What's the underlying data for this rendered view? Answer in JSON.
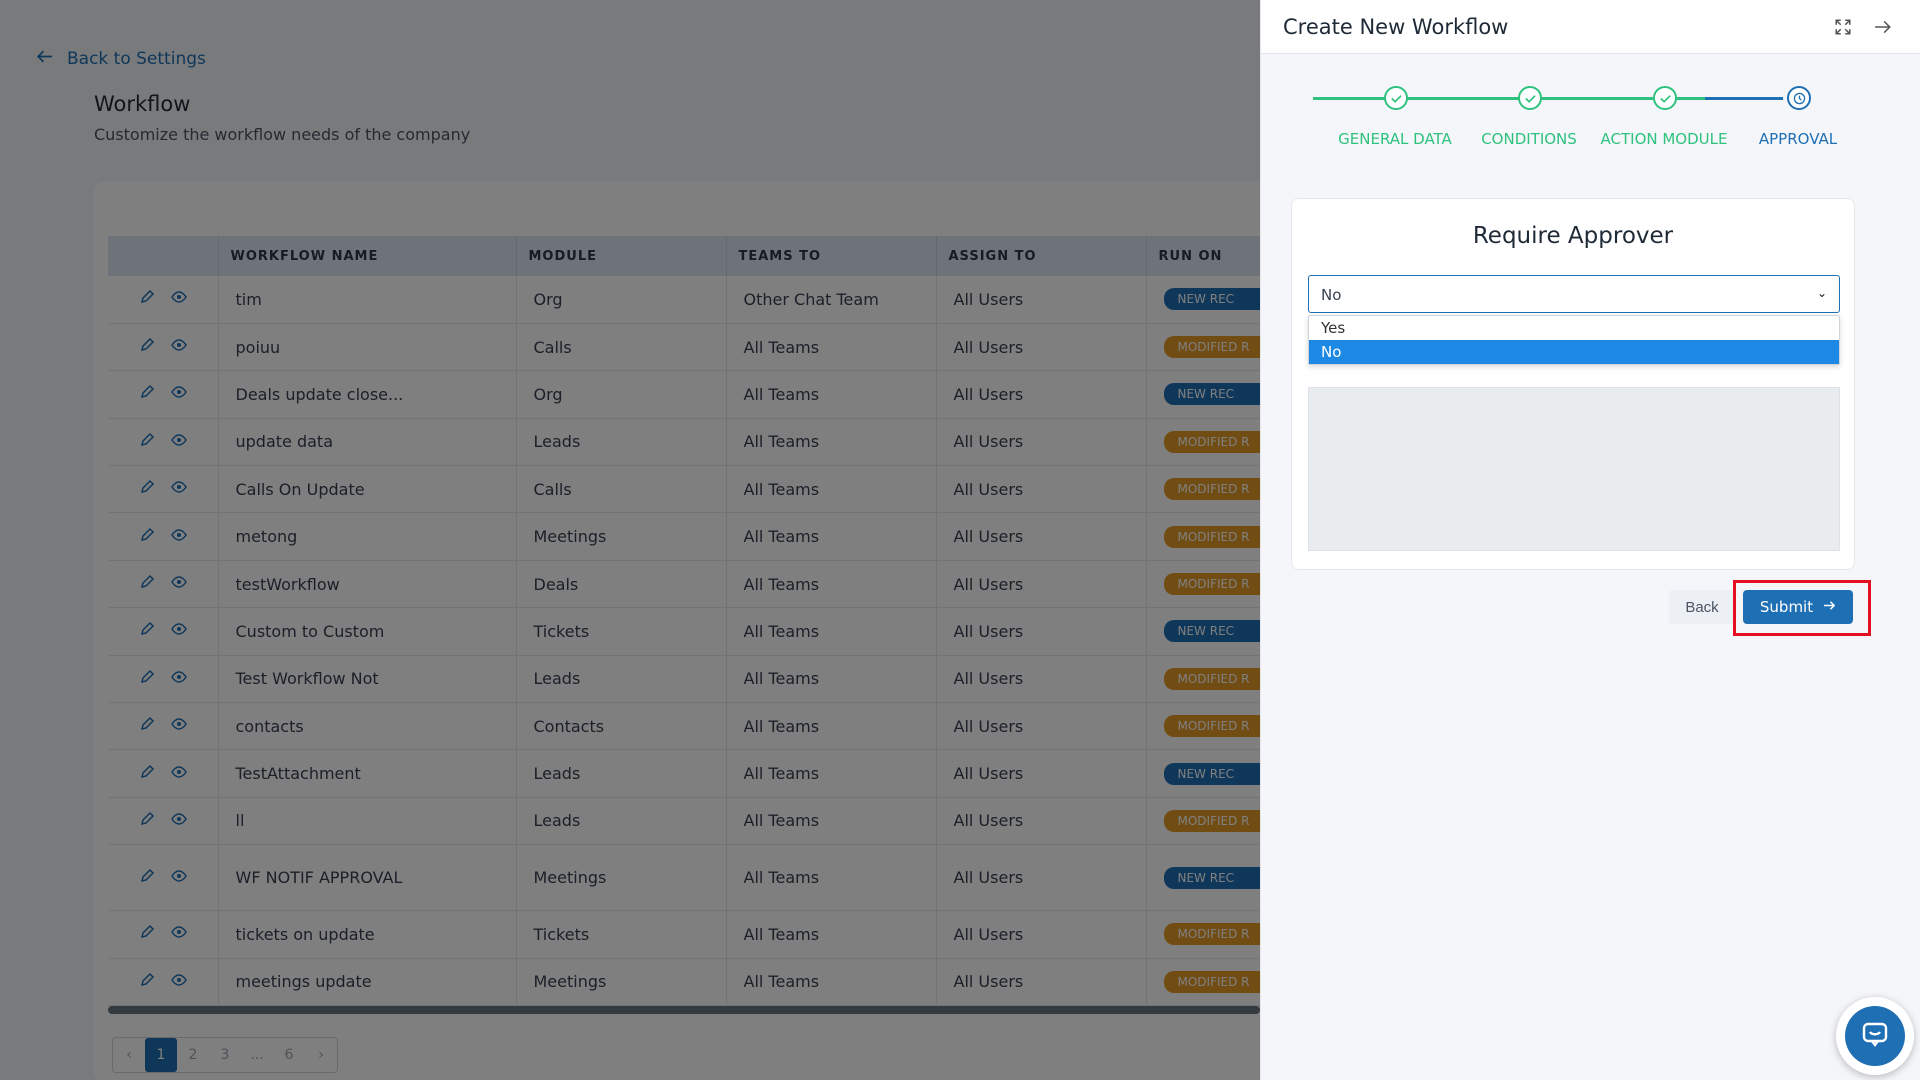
{
  "nav": {
    "back_label": "Back to Settings"
  },
  "page": {
    "title": "Workflow",
    "subtitle": "Customize the workflow needs of the company"
  },
  "table": {
    "columns": [
      "",
      "WORKFLOW NAME",
      "MODULE",
      "TEAMS TO",
      "ASSIGN TO",
      "RUN ON"
    ],
    "rows": [
      {
        "name": "tim",
        "module": "Org",
        "teams": "Other Chat Team",
        "assign": "All Users",
        "run_on": "NEW REC",
        "run_type": "new"
      },
      {
        "name": "poiuu",
        "module": "Calls",
        "teams": "All Teams",
        "assign": "All Users",
        "run_on": "MODIFIED R",
        "run_type": "mod"
      },
      {
        "name": "Deals update close...",
        "module": "Org",
        "teams": "All Teams",
        "assign": "All Users",
        "run_on": "NEW REC",
        "run_type": "new"
      },
      {
        "name": "update data",
        "module": "Leads",
        "teams": "All Teams",
        "assign": "All Users",
        "run_on": "MODIFIED R",
        "run_type": "mod"
      },
      {
        "name": "Calls On Update",
        "module": "Calls",
        "teams": "All Teams",
        "assign": "All Users",
        "run_on": "MODIFIED R",
        "run_type": "mod"
      },
      {
        "name": "metong",
        "module": "Meetings",
        "teams": "All Teams",
        "assign": "All Users",
        "run_on": "MODIFIED R",
        "run_type": "mod"
      },
      {
        "name": "testWorkflow",
        "module": "Deals",
        "teams": "All Teams",
        "assign": "All Users",
        "run_on": "MODIFIED R",
        "run_type": "mod"
      },
      {
        "name": "Custom to Custom",
        "module": "Tickets",
        "teams": "All Teams",
        "assign": "All Users",
        "run_on": "NEW REC",
        "run_type": "new"
      },
      {
        "name": "Test Workflow Not",
        "module": "Leads",
        "teams": "All Teams",
        "assign": "All Users",
        "run_on": "MODIFIED R",
        "run_type": "mod"
      },
      {
        "name": "contacts",
        "module": "Contacts",
        "teams": "All Teams",
        "assign": "All Users",
        "run_on": "MODIFIED R",
        "run_type": "mod"
      },
      {
        "name": "TestAttachment",
        "module": "Leads",
        "teams": "All Teams",
        "assign": "All Users",
        "run_on": "NEW REC",
        "run_type": "new"
      },
      {
        "name": "ll",
        "module": "Leads",
        "teams": "All Teams",
        "assign": "All Users",
        "run_on": "MODIFIED R",
        "run_type": "mod"
      },
      {
        "name": "WF NOTIF APPROVAL",
        "module": "Meetings",
        "teams": "All Teams",
        "assign": "All Users",
        "run_on": "NEW REC",
        "run_type": "new"
      },
      {
        "name": "tickets on update",
        "module": "Tickets",
        "teams": "All Teams",
        "assign": "All Users",
        "run_on": "MODIFIED R",
        "run_type": "mod"
      },
      {
        "name": "meetings update",
        "module": "Meetings",
        "teams": "All Teams",
        "assign": "All Users",
        "run_on": "MODIFIED R",
        "run_type": "mod"
      }
    ]
  },
  "pagination": {
    "prev": "‹",
    "pages": [
      "1",
      "2",
      "3",
      "...",
      "6"
    ],
    "next": "›",
    "current": "1"
  },
  "drawer": {
    "title": "Create New Workflow",
    "steps": [
      {
        "label": "GENERAL DATA",
        "state": "done"
      },
      {
        "label": "CONDITIONS",
        "state": "done"
      },
      {
        "label": "ACTION MODULE",
        "state": "done"
      },
      {
        "label": "APPROVAL",
        "state": "current"
      }
    ],
    "approval": {
      "title": "Require Approver",
      "selected": "No",
      "options": [
        "Yes",
        "No"
      ]
    },
    "back_label": "Back",
    "submit_label": "Submit"
  },
  "colors": {
    "primary": "#1f6fb4",
    "success": "#2ec27e",
    "warning": "#e39a26",
    "highlight": "#e5101f"
  },
  "icons": {
    "back": "arrow-left-icon",
    "expand": "expand-icon",
    "close": "arrow-right-icon",
    "edit": "pencil-icon",
    "view": "eye-icon",
    "check": "check-icon",
    "clock": "clock-icon",
    "chat": "chat-icon"
  }
}
